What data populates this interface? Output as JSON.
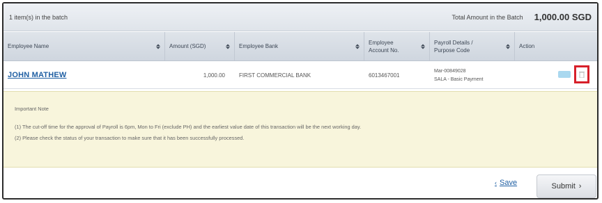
{
  "batch": {
    "count_text": "1 item(s) in the batch",
    "total_label": "Total Amount in the Batch",
    "total_value": "1,000.00 SGD"
  },
  "table": {
    "columns": [
      {
        "label": "Employee Name",
        "sortable": true
      },
      {
        "label": "Amount (SGD)",
        "sortable": true
      },
      {
        "label": "Employee Bank",
        "sortable": true
      },
      {
        "label": "Employee Account No.",
        "sortable": true
      },
      {
        "label": "Payroll Details / Purpose Code",
        "sortable": true
      },
      {
        "label": "Action",
        "sortable": false
      }
    ],
    "rows": [
      {
        "name": "JOHN MATHEW",
        "amount": "1,000.00",
        "bank": "FIRST COMMERCIAL BANK",
        "account": "6013467001",
        "details_line1": "Mar-00849028",
        "details_line2": "SALA - Basic Payment",
        "actions": [
          {
            "name": "edit",
            "icon": "pencil-icon",
            "color": "#a9d8ef"
          },
          {
            "name": "delete",
            "icon": "trash-icon",
            "highlight_color": "#d7202a"
          }
        ]
      }
    ]
  },
  "note": {
    "title": "Important Note",
    "line1": "(1) The cut-off time for the approval of Payroll is 6pm, Mon to Fri (exclude PH) and the earliest value date of this transaction will be the next working day.",
    "line2": "(2) Please check the status of your transaction to make sure that it has been successfully processed."
  },
  "footer": {
    "save_label": "Save",
    "submit_label": "Submit"
  },
  "colors": {
    "link": "#1f5fa3",
    "highlight": "#d7202a",
    "note_bg": "#f8f5dc"
  }
}
